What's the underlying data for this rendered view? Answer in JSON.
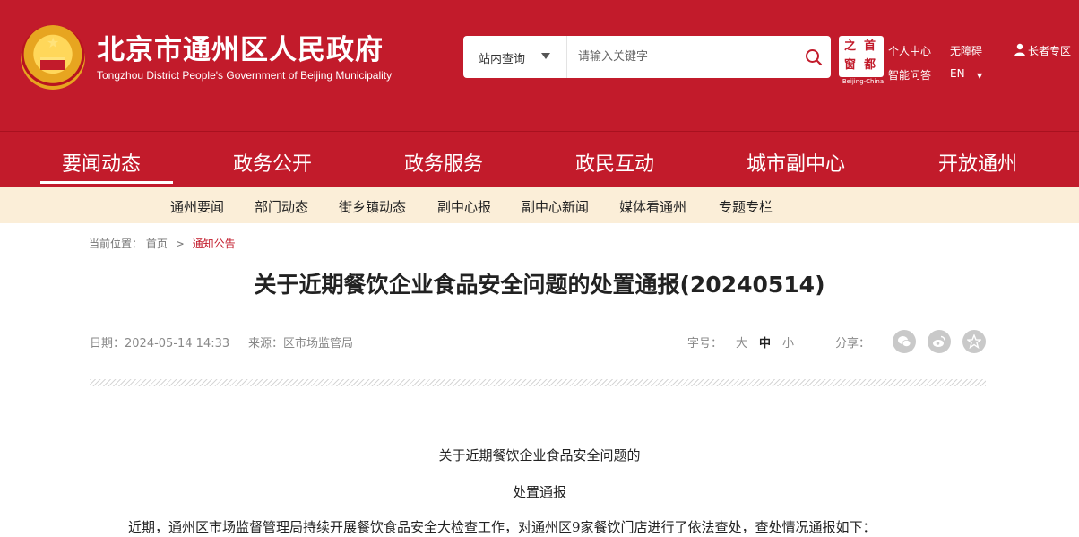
{
  "header": {
    "title": "北京市通州区人民政府",
    "subtitle": "Tongzhou District People's Government of Beijing Municipality",
    "search": {
      "scope_label": "站内查询",
      "placeholder": "请输入关键字"
    },
    "capital_logo": {
      "chars": [
        "之",
        "首",
        "窗",
        "都"
      ],
      "caption": "Beijing-China"
    },
    "links": {
      "personal_center": "个人中心",
      "accessibility": "无障碍",
      "elder_zone": "长者专区",
      "smart_qa": "智能问答",
      "language": "EN"
    }
  },
  "main_nav": [
    {
      "label": "要闻动态",
      "active": true
    },
    {
      "label": "政务公开"
    },
    {
      "label": "政务服务"
    },
    {
      "label": "政民互动"
    },
    {
      "label": "城市副中心"
    },
    {
      "label": "开放通州"
    }
  ],
  "sub_nav": [
    "通州要闻",
    "部门动态",
    "街乡镇动态",
    "副中心报",
    "副中心新闻",
    "媒体看通州",
    "专题专栏"
  ],
  "breadcrumb": {
    "prefix": "当前位置：",
    "home": "首页",
    "separator": ">",
    "current": "通知公告"
  },
  "article": {
    "title": "关于近期餐饮企业食品安全问题的处置通报(20240514)",
    "date": "日期：2024-05-14 14:33",
    "source": "来源：区市场监管局",
    "font_size_label": "字号：",
    "font_sizes": [
      "大",
      "中",
      "小"
    ],
    "font_size_active": "中",
    "share_label": "分享：",
    "share_icons": [
      "wechat-icon",
      "weibo-icon",
      "favorite-icon"
    ],
    "body_heading_1": "关于近期餐饮企业食品安全问题的",
    "body_heading_2": "处置通报",
    "body_para_1": "近期，通州区市场监督管理局持续开展餐饮食品安全大检查工作，对通州区9家餐饮门店进行了依法查处，查处情况通报如下："
  },
  "colors": {
    "brand_red": "#c21b2b",
    "subnav_bg": "#fbeed8"
  }
}
